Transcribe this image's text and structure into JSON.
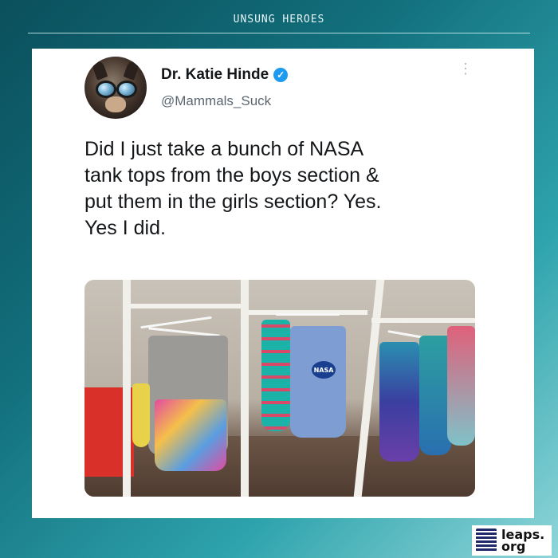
{
  "header": {
    "label": "UNSUNG HEROES"
  },
  "tweet": {
    "author_name": "Dr. Katie Hinde",
    "handle": "@Mammals_Suck",
    "verified_glyph": "✓",
    "more_glyph": "⋮",
    "lines": [
      "Did I just take a bunch of NASA",
      "tank tops from the boys section &",
      "put them in the girls section? Yes.",
      "Yes I did."
    ],
    "photo_print_text": "NASA"
  },
  "brand": {
    "line1": "leaps.",
    "line2": "org"
  },
  "colors": {
    "background_dark": "#0b4f5c",
    "background_light": "#8fd6d9",
    "verified_blue": "#1d9bf0",
    "text": "#14171a",
    "handle_gray": "#5b6670"
  },
  "icons": {
    "verified": "verified-badge-icon",
    "more": "more-options-icon",
    "brand": "leaps-logo-icon"
  }
}
